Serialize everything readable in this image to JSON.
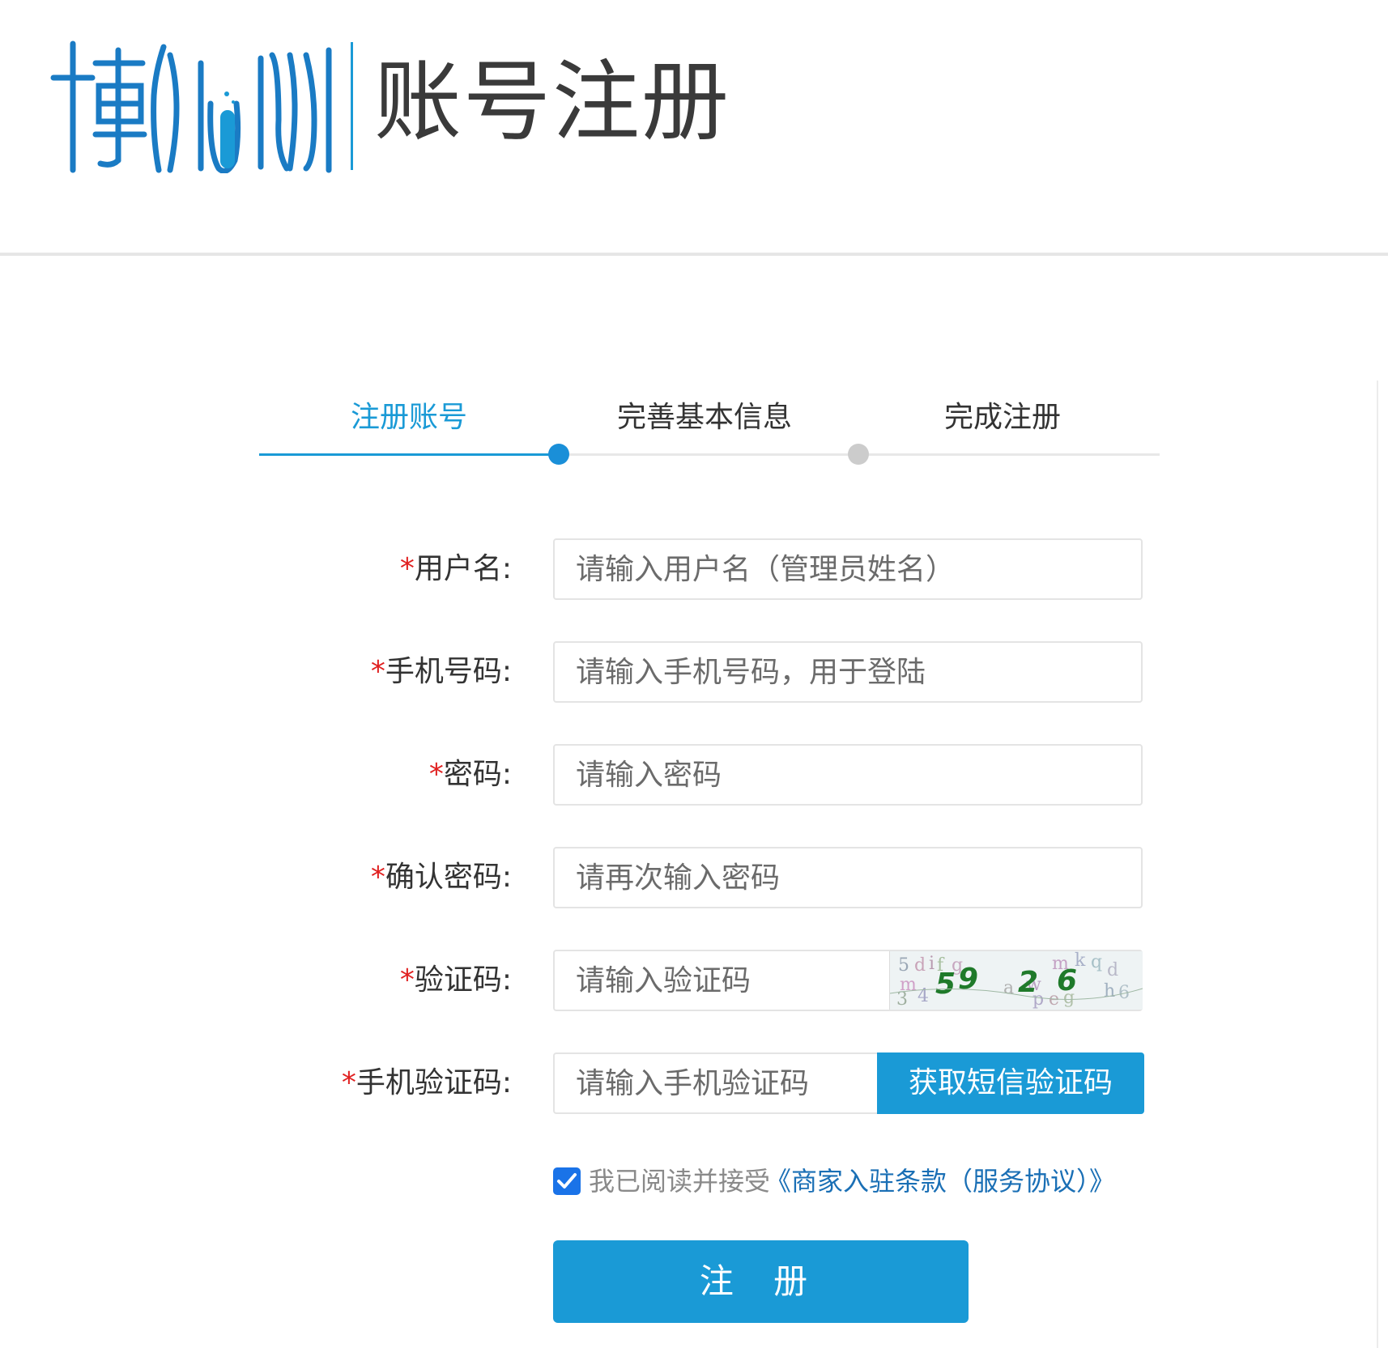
{
  "header": {
    "logo_alt": "博佃",
    "title": "账号注册",
    "brand_color": "#1a9ad6"
  },
  "steps": [
    {
      "label": "注册账号",
      "state": "active"
    },
    {
      "label": "完善基本信息",
      "state": "pending"
    },
    {
      "label": "完成注册",
      "state": "pending"
    }
  ],
  "form": {
    "required_mark": "*",
    "username": {
      "label": "用户名:",
      "placeholder": "请输入用户名（管理员姓名）",
      "value": ""
    },
    "phone": {
      "label": "手机号码:",
      "placeholder": "请输入手机号码，用于登陆",
      "value": ""
    },
    "password": {
      "label": "密码:",
      "placeholder": "请输入密码",
      "value": ""
    },
    "confirm_password": {
      "label": "确认密码:",
      "placeholder": "请再次输入密码",
      "value": ""
    },
    "captcha": {
      "label": "验证码:",
      "placeholder": "请输入验证码",
      "value": "",
      "image_text": "5926"
    },
    "sms_code": {
      "label": "手机验证码:",
      "placeholder": "请输入手机验证码",
      "value": "",
      "button_label": "获取短信验证码"
    }
  },
  "agreement": {
    "checked": true,
    "text": "我已阅读并接受",
    "link": "《商家入驻条款（服务协议）》"
  },
  "submit": {
    "label": "注 册"
  },
  "colors": {
    "primary": "#1a9ad6",
    "required": "#e02020",
    "link": "#1a6fb5"
  }
}
